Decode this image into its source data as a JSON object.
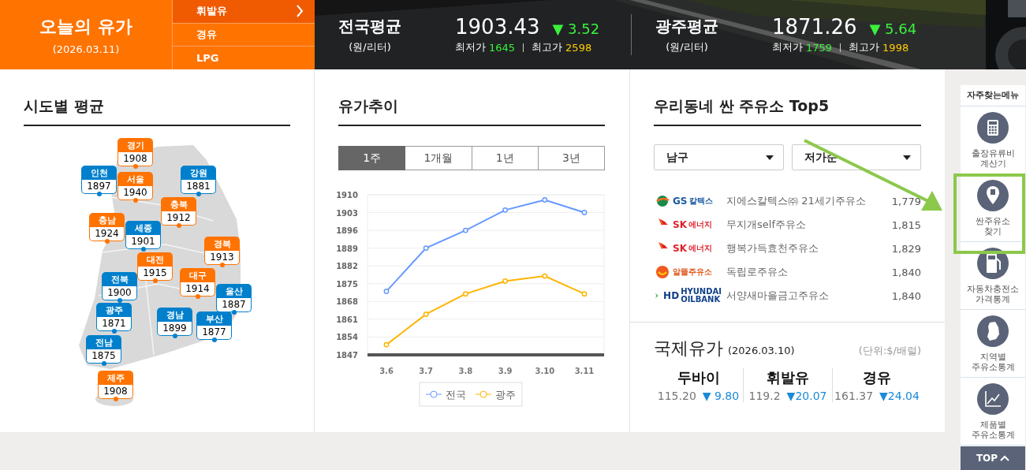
{
  "header": {
    "title": "오늘의 유가",
    "date": "(2026.03.11)",
    "fuel_tabs": [
      {
        "label": "휘발유",
        "selected": true
      },
      {
        "label": "경유",
        "selected": false
      },
      {
        "label": "LPG",
        "selected": false
      }
    ],
    "averages": [
      {
        "title": "전국평균",
        "unit": "(원/리터)",
        "price": "1903.43",
        "change": "▼ 3.52",
        "min_label": "최저가",
        "min": "1645",
        "max_label": "최고가",
        "max": "2598"
      },
      {
        "title": "광주평균",
        "unit": "(원/리터)",
        "price": "1871.26",
        "change": "▼ 5.64",
        "min_label": "최저가",
        "min": "1759",
        "max_label": "최고가",
        "max": "1998"
      }
    ]
  },
  "regional": {
    "title": "시도별 평균",
    "regions": [
      {
        "name": "경기",
        "price": "1908",
        "color": "#ff7300"
      },
      {
        "name": "인천",
        "price": "1897",
        "color": "#0080cc"
      },
      {
        "name": "서울",
        "price": "1940",
        "color": "#ff7300"
      },
      {
        "name": "강원",
        "price": "1881",
        "color": "#0080cc"
      },
      {
        "name": "충북",
        "price": "1912",
        "color": "#ff7300"
      },
      {
        "name": "충남",
        "price": "1924",
        "color": "#ff7300"
      },
      {
        "name": "세종",
        "price": "1901",
        "color": "#0080cc"
      },
      {
        "name": "경북",
        "price": "1913",
        "color": "#ff7300"
      },
      {
        "name": "대전",
        "price": "1915",
        "color": "#ff7300"
      },
      {
        "name": "전북",
        "price": "1900",
        "color": "#0080cc"
      },
      {
        "name": "대구",
        "price": "1914",
        "color": "#ff7300"
      },
      {
        "name": "울산",
        "price": "1887",
        "color": "#0080cc"
      },
      {
        "name": "광주",
        "price": "1871",
        "color": "#0080cc"
      },
      {
        "name": "경남",
        "price": "1899",
        "color": "#0080cc"
      },
      {
        "name": "부산",
        "price": "1877",
        "color": "#0080cc"
      },
      {
        "name": "전남",
        "price": "1875",
        "color": "#0080cc"
      },
      {
        "name": "제주",
        "price": "1908",
        "color": "#ff7300"
      }
    ]
  },
  "trend": {
    "title": "유가추이",
    "periods": [
      {
        "label": "1주",
        "selected": true
      },
      {
        "label": "1개월",
        "selected": false
      },
      {
        "label": "1년",
        "selected": false
      },
      {
        "label": "3년",
        "selected": false
      }
    ],
    "chart_data": {
      "type": "line",
      "categories": [
        "3.6",
        "3.7",
        "3.8",
        "3.9",
        "3.10",
        "3.11"
      ],
      "series": [
        {
          "name": "전국",
          "color": "#6699ff",
          "marker": "circle",
          "values": [
            1872,
            1889,
            1896,
            1904,
            1908,
            1903
          ]
        },
        {
          "name": "광주",
          "color": "#ffb400",
          "marker": "circle",
          "values": [
            1851,
            1863,
            1871,
            1876,
            1878,
            1871
          ]
        }
      ],
      "ylim": [
        1847,
        1910
      ],
      "yticks": [
        1847,
        1854,
        1861,
        1868,
        1875,
        1882,
        1889,
        1896,
        1903,
        1910
      ],
      "grid": true,
      "legend": true
    }
  },
  "cheap_stations": {
    "title": "우리동네 싼 주유소 Top5",
    "filters": [
      {
        "value": "남구"
      },
      {
        "value": "저가순"
      }
    ],
    "stations": [
      {
        "brand": {
          "kind": "gs",
          "mark": "GS",
          "text": "칼텍스"
        },
        "name": "지에스칼텍스㈜ 21세기주유소",
        "price": "1,779"
      },
      {
        "brand": {
          "kind": "sk",
          "mark": "SK",
          "text": "에너지"
        },
        "name": "무지개self주유소",
        "price": "1,815"
      },
      {
        "brand": {
          "kind": "sk",
          "mark": "SK",
          "text": "에너지"
        },
        "name": "행복가득효천주유소",
        "price": "1,829"
      },
      {
        "brand": {
          "kind": "alddle",
          "text": "알뜰주유소"
        },
        "name": "독립로주유소",
        "price": "1,840"
      },
      {
        "brand": {
          "kind": "hd",
          "mark": "HD",
          "text": "HYUNDAI OILBANK"
        },
        "name": "서양새마을금고주유소",
        "price": "1,840"
      }
    ]
  },
  "international": {
    "title": "국제유가",
    "date": "(2026.03.10)",
    "unit": "(단위:$/배럴)",
    "items": [
      {
        "name": "두바이",
        "price": "115.20",
        "change": "▼ 9.80"
      },
      {
        "name": "휘발유",
        "price": "119.2",
        "change": "▼20.07"
      },
      {
        "name": "경유",
        "price": "161.37",
        "change": "▼24.04"
      }
    ]
  },
  "quick_menu": {
    "title": "자주찾는메뉴",
    "items": [
      {
        "label": "출장유류비\n계산기",
        "kind": "calculator",
        "highlighted": false
      },
      {
        "label": "싼주유소\n찾기",
        "kind": "pin",
        "highlighted": true
      },
      {
        "label": "자동차충전소\n가격통계",
        "kind": "pump",
        "highlighted": false
      },
      {
        "label": "지역별\n주유소통계",
        "kind": "map",
        "highlighted": false
      },
      {
        "label": "제품별\n주유소통계",
        "kind": "chart",
        "highlighted": false
      }
    ],
    "top_button": "TOP"
  }
}
